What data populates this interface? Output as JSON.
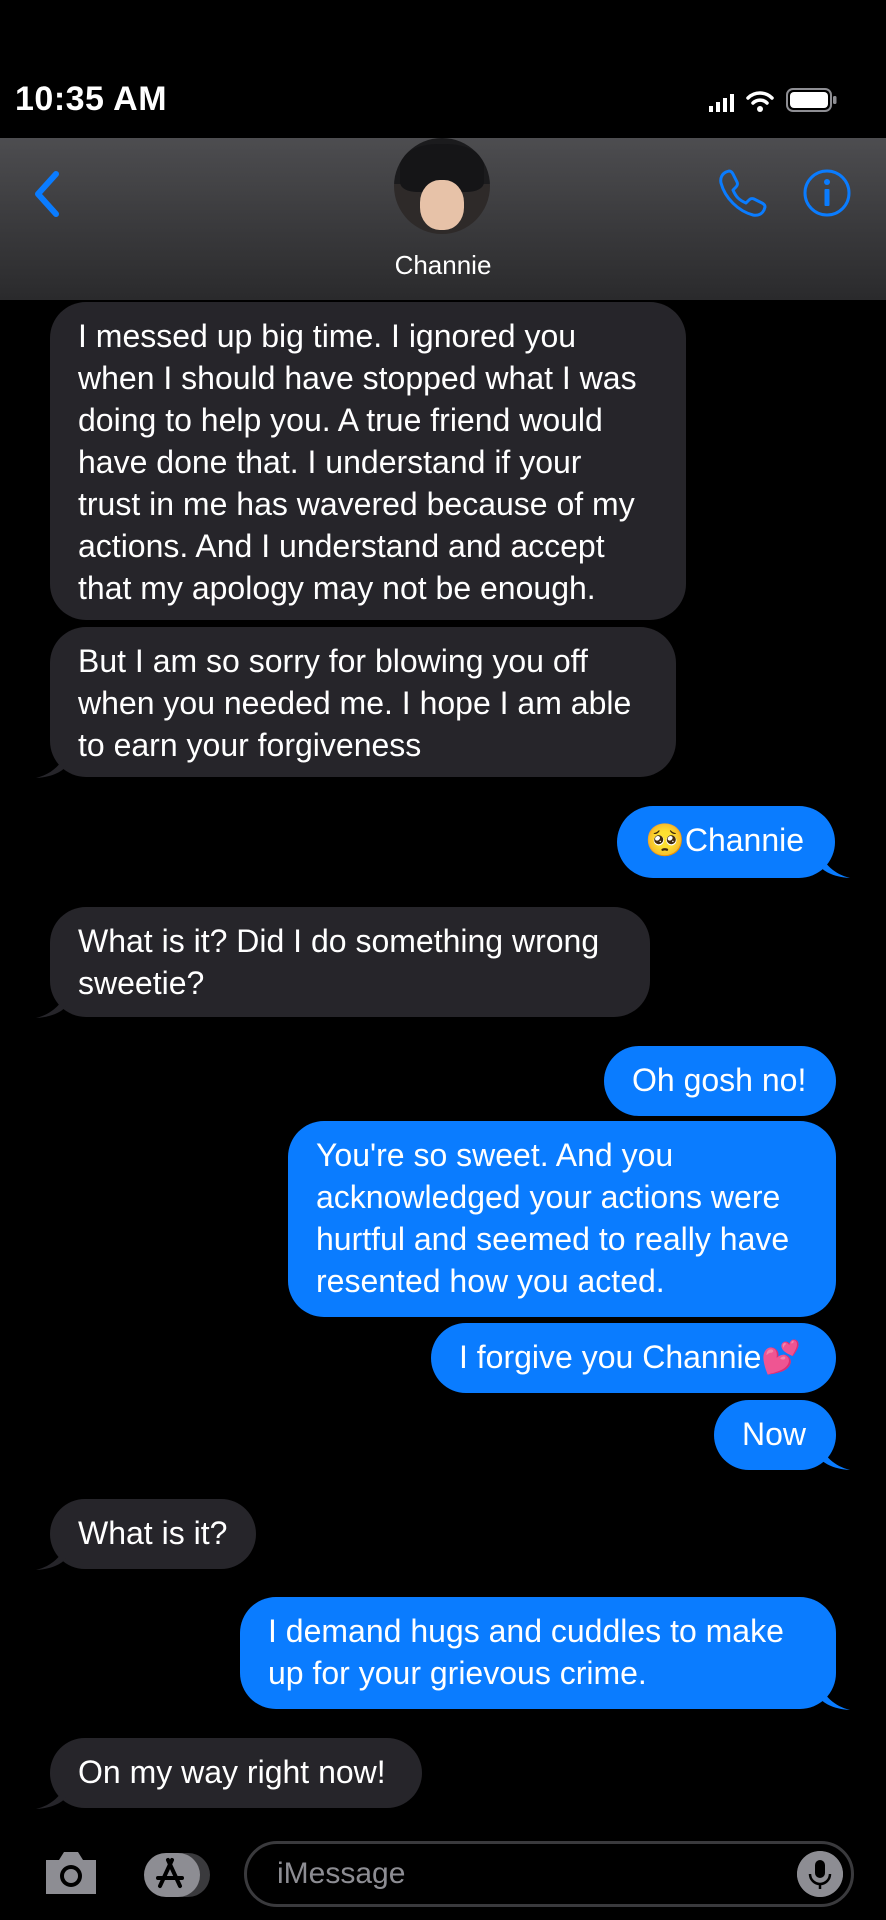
{
  "status_bar": {
    "time": "10:35 AM"
  },
  "header": {
    "contact_name": "Channie"
  },
  "messages": [
    {
      "from": "contact",
      "text": "I messed up big time. I ignored you\nwhen I should have stopped what I was\ndoing to help you. A true friend would\nhave done that. I understand if your\ntrust in me has wavered because of my\nactions. And I understand and accept\nthat my apology may not be enough."
    },
    {
      "from": "contact",
      "text": "But I am so sorry for blowing you off\nwhen you needed me. I hope I am able\nto earn your forgiveness"
    },
    {
      "from": "me",
      "text": "🥺Channie"
    },
    {
      "from": "contact",
      "text": "What is it? Did I do something wrong\nsweetie?"
    },
    {
      "from": "me",
      "text": "Oh gosh no!"
    },
    {
      "from": "me",
      "text": "You're so sweet. And you\nacknowledged your actions were\nhurtful and seemed to really have\nresented how you acted."
    },
    {
      "from": "me",
      "text": "I forgive you Channie💕"
    },
    {
      "from": "me",
      "text": "Now"
    },
    {
      "from": "contact",
      "text": "What is it?"
    },
    {
      "from": "me",
      "text": "I demand hugs and cuddles to make\nup for your grievous crime."
    },
    {
      "from": "contact",
      "text": "On my way right now!"
    }
  ],
  "input": {
    "placeholder": "iMessage"
  },
  "colors": {
    "outgoing": "#0a7cff",
    "incoming": "#26252a",
    "accent": "#0a7cff"
  },
  "icons": [
    "back-chevron-icon",
    "phone-icon",
    "info-icon",
    "camera-icon",
    "app-store-icon",
    "microphone-icon"
  ]
}
